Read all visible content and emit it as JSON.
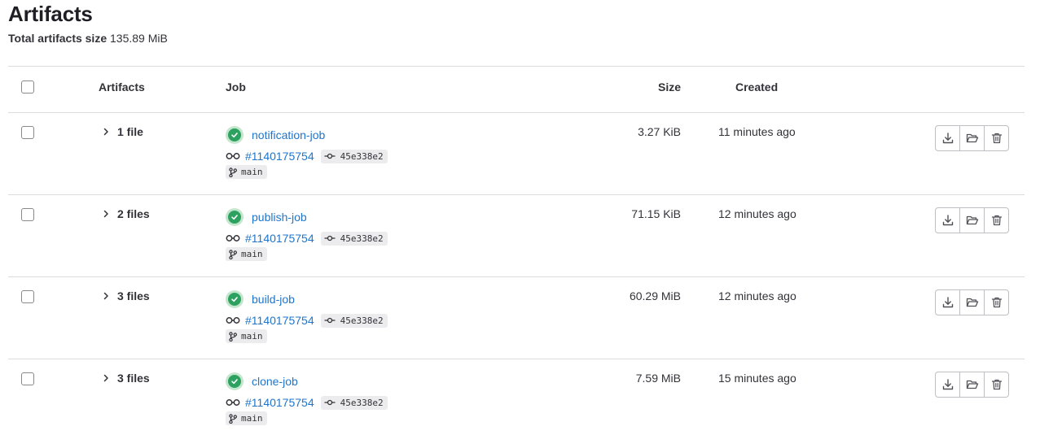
{
  "page": {
    "title": "Artifacts",
    "total_label": "Total artifacts size",
    "total_value": "135.89 MiB"
  },
  "table": {
    "headers": {
      "artifacts": "Artifacts",
      "job": "Job",
      "size": "Size",
      "created": "Created"
    },
    "rows": [
      {
        "files": "1 file",
        "job_name": "notification-job",
        "pipeline": "#1140175754",
        "sha": "45e338e2",
        "ref": "main",
        "size": "3.27 KiB",
        "created": "11 minutes ago"
      },
      {
        "files": "2 files",
        "job_name": "publish-job",
        "pipeline": "#1140175754",
        "sha": "45e338e2",
        "ref": "main",
        "size": "71.15 KiB",
        "created": "12 minutes ago"
      },
      {
        "files": "3 files",
        "job_name": "build-job",
        "pipeline": "#1140175754",
        "sha": "45e338e2",
        "ref": "main",
        "size": "60.29 MiB",
        "created": "12 minutes ago"
      },
      {
        "files": "3 files",
        "job_name": "clone-job",
        "pipeline": "#1140175754",
        "sha": "45e338e2",
        "ref": "main",
        "size": "7.59 MiB",
        "created": "15 minutes ago"
      }
    ]
  },
  "icons": {
    "status": "status-success-icon",
    "pipeline": "pipeline-icon",
    "commit": "commit-icon",
    "branch": "branch-icon",
    "expand": "chevron-right-icon",
    "download": "download-icon",
    "browse": "folder-open-icon",
    "delete": "remove-icon"
  },
  "colors": {
    "link": "#1f75cb",
    "success": "#2da160",
    "success_bg": "#c3e6cd",
    "border": "#dcdcde"
  }
}
